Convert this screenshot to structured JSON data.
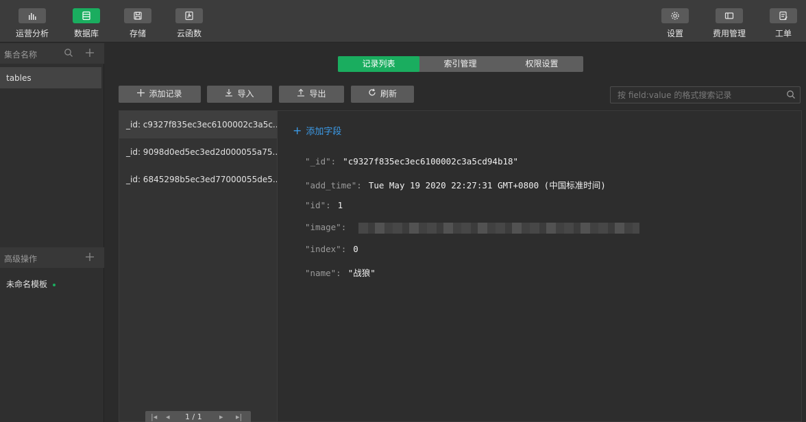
{
  "toolbar": {
    "left": [
      {
        "label": "运营分析",
        "icon": "bar-chart-icon"
      },
      {
        "label": "数据库",
        "icon": "database-icon"
      },
      {
        "label": "存储",
        "icon": "save-icon"
      },
      {
        "label": "云函数",
        "icon": "function-icon"
      }
    ],
    "right": [
      {
        "label": "设置",
        "icon": "gear-icon"
      },
      {
        "label": "费用管理",
        "icon": "panel-icon"
      },
      {
        "label": "工单",
        "icon": "ticket-icon"
      }
    ]
  },
  "sidebar": {
    "collections_title": "集合名称",
    "collections": [
      "tables"
    ],
    "advanced_title": "高级操作",
    "templates": [
      "未命名模板"
    ]
  },
  "tabs": [
    "记录列表",
    "索引管理",
    "权限设置"
  ],
  "actions": {
    "add_record": "添加记录",
    "import": "导入",
    "export": "导出",
    "refresh": "刷新"
  },
  "search": {
    "placeholder": "按 field:value 的格式搜索记录"
  },
  "records": [
    "_id: c9327f835ec3ec6100002c3a5c...",
    "_id: 9098d0ed5ec3ed2d000055a75...",
    "_id: 6845298b5ec3ed77000055de5..."
  ],
  "pager": {
    "label": "1 / 1"
  },
  "detail": {
    "add_field": "添加字段",
    "fields": [
      {
        "key": "\"_id\"",
        "value": "\"c9327f835ec3ec6100002c3a5cd94b18\""
      },
      {
        "key": "\"add_time\"",
        "value": "Tue May 19 2020 22:27:31 GMT+0800 (中国标准时间)"
      },
      {
        "key": "\"id\"",
        "value": "1"
      },
      {
        "key": "\"image\"",
        "value": ""
      },
      {
        "key": "\"index\"",
        "value": "0"
      },
      {
        "key": "\"name\"",
        "value": "\"战狼\""
      }
    ]
  },
  "colors": {
    "accent": "#1aad5f",
    "link": "#3c9be8"
  }
}
